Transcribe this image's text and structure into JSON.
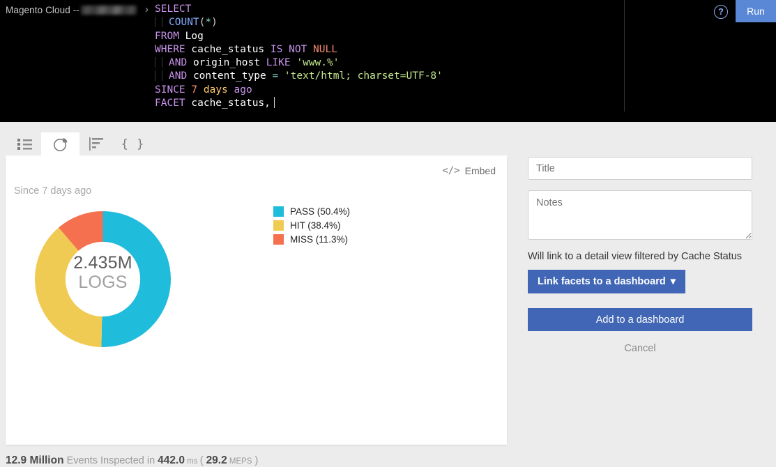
{
  "header": {
    "account_title": "Magento Cloud --",
    "account_redacted": true,
    "breadcrumb_chevron": "›",
    "help_icon": "?",
    "run_label": "Run"
  },
  "query": {
    "lines": [
      "SELECT",
      "    COUNT(*)",
      "FROM Log",
      "WHERE cache_status IS NOT NULL",
      "    AND origin_host LIKE 'www.%'",
      "    AND content_type = 'text/html; charset=UTF-8'",
      "SINCE 7 days ago",
      "FACET cache_status, "
    ],
    "full_text": "SELECT\n    COUNT(*)\nFROM Log\nWHERE cache_status IS NOT NULL\n    AND origin_host LIKE 'www.%'\n    AND content_type = 'text/html; charset=UTF-8'\nSINCE 7 days ago\nFACET cache_status, "
  },
  "tabs": [
    {
      "icon": "list-icon",
      "name": "tab-table",
      "active": false
    },
    {
      "icon": "pie-chart-icon",
      "name": "tab-pie-chart",
      "active": true
    },
    {
      "icon": "bar-chart-icon",
      "name": "tab-bar-chart",
      "active": false
    },
    {
      "icon": "json-icon",
      "name": "tab-json",
      "active": false
    }
  ],
  "card": {
    "embed_label": "Embed",
    "embed_icon": "</>",
    "since_label": "Since 7 days ago"
  },
  "chart_data": {
    "type": "pie",
    "title": "",
    "subtitle": "Since 7 days ago",
    "center_value": "2.435M",
    "center_unit": "LOGS",
    "total": 2435000,
    "legend_position": "right",
    "donut": true,
    "inner_radius_ratio": 0.55,
    "start_angle_deg": 0,
    "direction": "clockwise",
    "categories": [
      "PASS",
      "HIT",
      "MISS"
    ],
    "values": [
      50.4,
      38.4,
      11.3
    ],
    "labels": [
      "PASS (50.4%)",
      "HIT (38.4%)",
      "MISS (11.3%)"
    ],
    "colors": [
      "#20bcdc",
      "#f0cb53",
      "#f4704f"
    ],
    "unit": "percent"
  },
  "side_panel": {
    "title_placeholder": "Title",
    "title_value": "",
    "notes_placeholder": "Notes",
    "notes_value": "",
    "link_hint": "Will link to a detail view filtered by Cache Status",
    "link_facets_label": "Link facets to a dashboard",
    "link_facets_caret": "▾",
    "add_dashboard_label": "Add to a dashboard",
    "cancel_label": "Cancel"
  },
  "status_bar": {
    "events_count": "12.9 Million",
    "events_text": " Events Inspected in ",
    "duration": "442.0",
    "duration_unit": " ms ",
    "open_paren": "( ",
    "rate": "29.2",
    "rate_unit": " MEPS",
    "close_paren": " )"
  },
  "colors": {
    "accent_blue": "#4066b5",
    "run_blue": "#5b88d6",
    "pass": "#20bcdc",
    "hit": "#f0cb53",
    "miss": "#f4704f",
    "page_bg": "#ececec",
    "editor_bg": "#000000"
  }
}
